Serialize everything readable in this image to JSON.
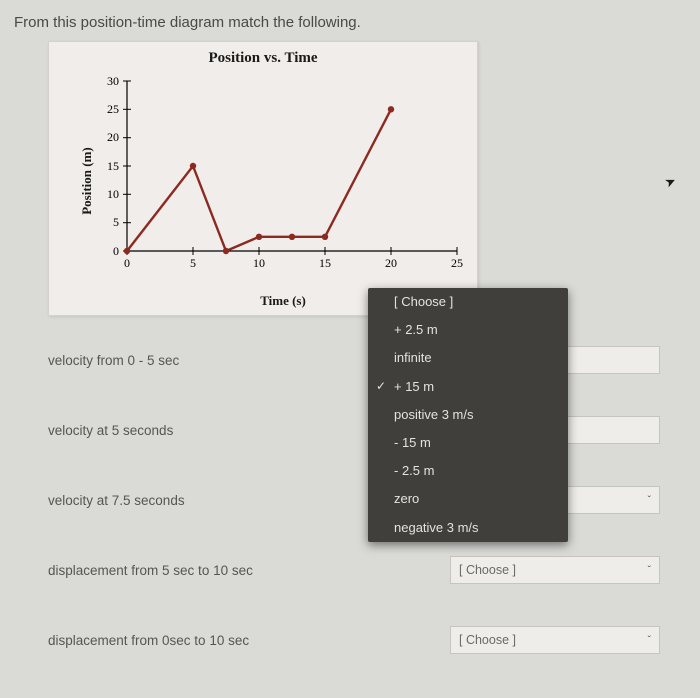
{
  "question": "From this position-time diagram match the following.",
  "chart": {
    "title": "Position vs. Time",
    "xlabel": "Time (s)",
    "ylabel": "Position (m)",
    "x_ticks": [
      "0",
      "5",
      "10",
      "15",
      "20",
      "25"
    ],
    "y_ticks": [
      "0",
      "5",
      "10",
      "15",
      "20",
      "25",
      "30"
    ]
  },
  "chart_data": {
    "type": "line",
    "title": "Position vs. Time",
    "xlabel": "Time (s)",
    "ylabel": "Position (m)",
    "xlim": [
      0,
      25
    ],
    "ylim": [
      0,
      30
    ],
    "series": [
      {
        "name": "Position",
        "x": [
          0,
          5,
          7.5,
          10,
          12.5,
          15,
          20
        ],
        "y": [
          0,
          15,
          0,
          2.5,
          2.5,
          2.5,
          25
        ]
      }
    ]
  },
  "prompts": [
    {
      "label": "velocity from 0 - 5 sec",
      "value": ""
    },
    {
      "label": "velocity at 5 seconds",
      "value": ""
    },
    {
      "label": "velocity at 7.5 seconds",
      "value": "[ Choose ]"
    },
    {
      "label": "displacement from 5 sec to 10 sec",
      "value": "[ Choose ]"
    },
    {
      "label": "displacement from 0sec to 10 sec",
      "value": "[ Choose ]"
    }
  ],
  "dropdown": {
    "header": "[ Choose ]",
    "options": [
      "+ 2.5 m",
      "infinite",
      "+ 15 m",
      "positive 3 m/s",
      "- 15 m",
      "- 2.5 m",
      "zero",
      "negative 3 m/s"
    ],
    "selected_index": 2
  }
}
